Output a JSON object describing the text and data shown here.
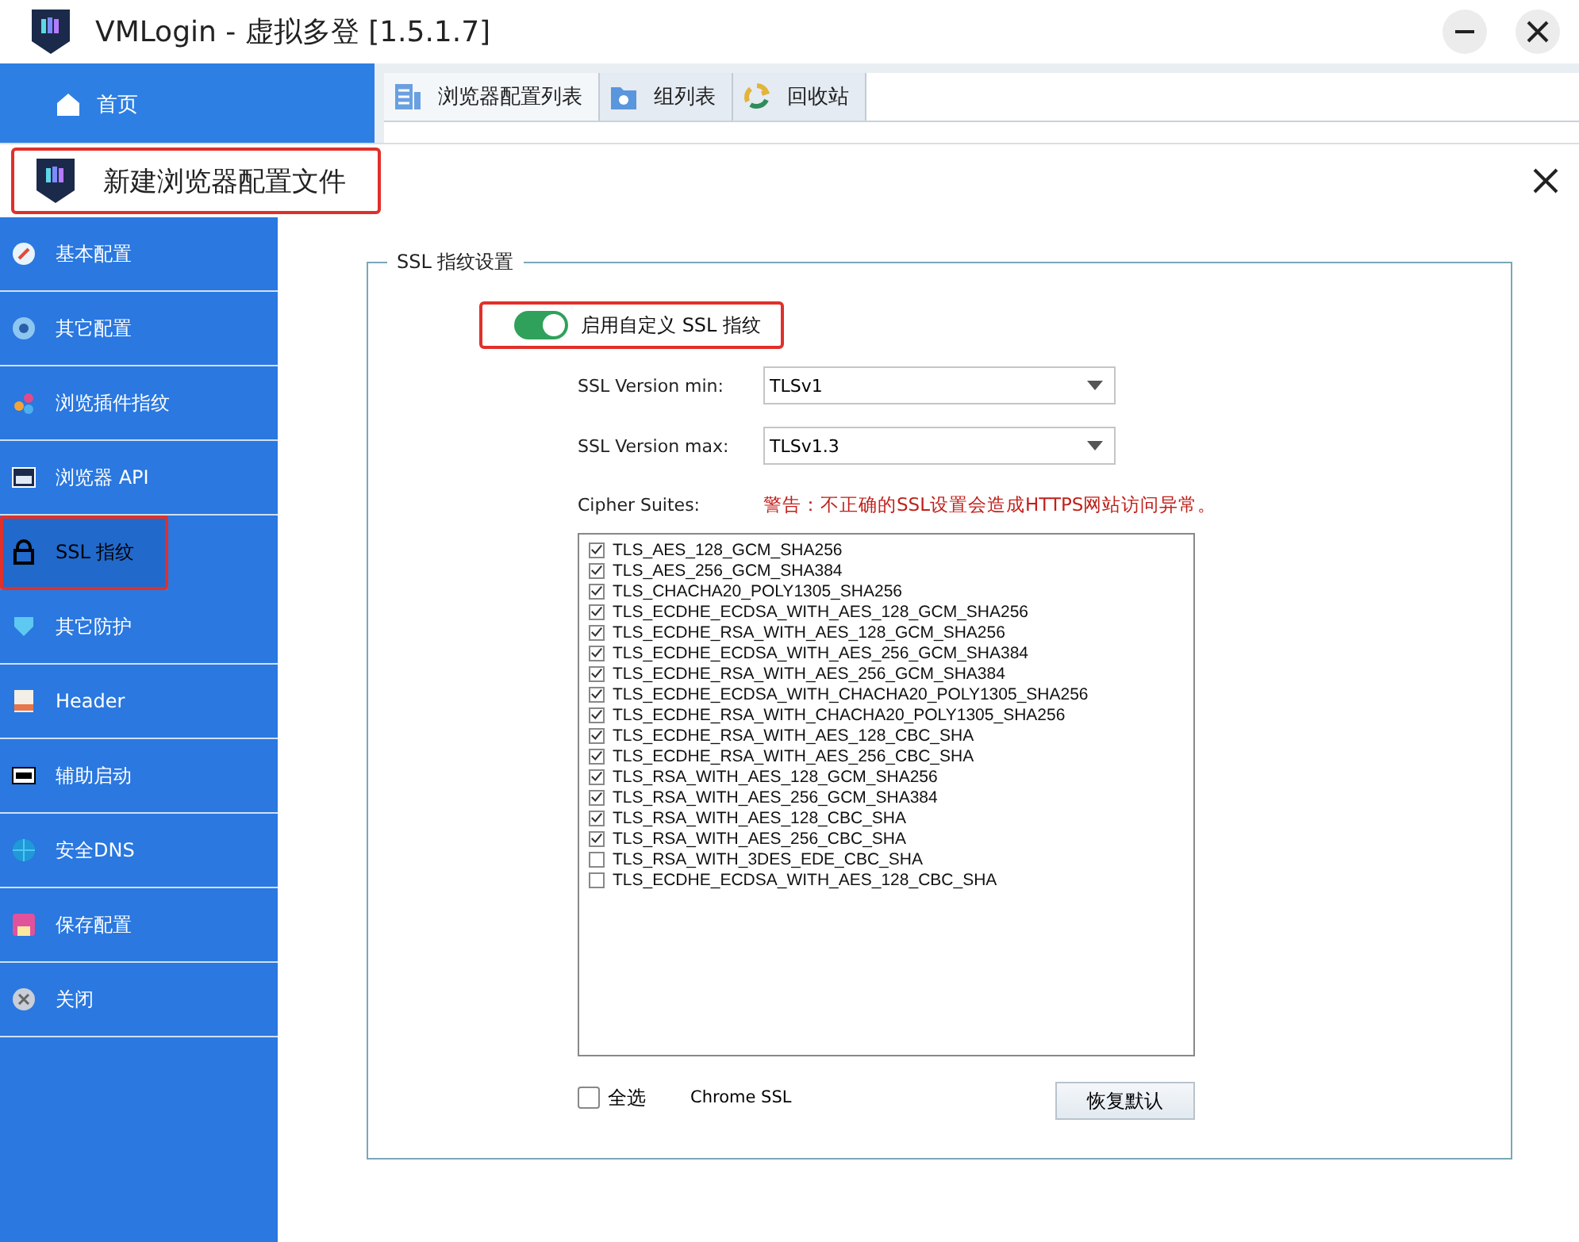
{
  "window": {
    "title": "VMLogin - 虚拟多登 [1.5.1.7]"
  },
  "main_nav": {
    "home": "首页"
  },
  "tabs": [
    {
      "label": "浏览器配置列表",
      "selected": true
    },
    {
      "label": "组列表",
      "selected": false
    },
    {
      "label": "回收站",
      "selected": false
    }
  ],
  "dialog": {
    "title": "新建浏览器配置文件",
    "highlighted": true
  },
  "sidebar": {
    "items": [
      {
        "label": "基本配置",
        "selected": false,
        "highlighted": false
      },
      {
        "label": "其它配置",
        "selected": false,
        "highlighted": false
      },
      {
        "label": "浏览插件指纹",
        "selected": false,
        "highlighted": false
      },
      {
        "label": "浏览器 API",
        "selected": false,
        "highlighted": false
      },
      {
        "label": "SSL 指纹",
        "selected": true,
        "highlighted": true
      },
      {
        "label": "其它防护",
        "selected": false,
        "highlighted": false
      },
      {
        "label": "Header",
        "selected": false,
        "highlighted": false
      },
      {
        "label": "辅助启动",
        "selected": false,
        "highlighted": false
      },
      {
        "label": "安全DNS",
        "selected": false,
        "highlighted": false
      },
      {
        "label": "保存配置",
        "selected": false,
        "highlighted": false
      },
      {
        "label": "关闭",
        "selected": false,
        "highlighted": false
      }
    ]
  },
  "ssl": {
    "group_title": "SSL 指纹设置",
    "toggle": {
      "label": "启用自定义 SSL 指纹",
      "on": true,
      "highlighted": true
    },
    "version_min": {
      "label": "SSL Version min:",
      "value": "TLSv1"
    },
    "version_max": {
      "label": "SSL Version max:",
      "value": "TLSv1.3"
    },
    "cipher_label": "Cipher Suites:",
    "warning": "警告：不正确的SSL设置会造成HTTPS网站访问异常。",
    "ciphers": [
      {
        "name": "TLS_AES_128_GCM_SHA256",
        "checked": true
      },
      {
        "name": "TLS_AES_256_GCM_SHA384",
        "checked": true
      },
      {
        "name": "TLS_CHACHA20_POLY1305_SHA256",
        "checked": true
      },
      {
        "name": "TLS_ECDHE_ECDSA_WITH_AES_128_GCM_SHA256",
        "checked": true
      },
      {
        "name": "TLS_ECDHE_RSA_WITH_AES_128_GCM_SHA256",
        "checked": true
      },
      {
        "name": "TLS_ECDHE_ECDSA_WITH_AES_256_GCM_SHA384",
        "checked": true
      },
      {
        "name": "TLS_ECDHE_RSA_WITH_AES_256_GCM_SHA384",
        "checked": true
      },
      {
        "name": "TLS_ECDHE_ECDSA_WITH_CHACHA20_POLY1305_SHA256",
        "checked": true
      },
      {
        "name": "TLS_ECDHE_RSA_WITH_CHACHA20_POLY1305_SHA256",
        "checked": true
      },
      {
        "name": "TLS_ECDHE_RSA_WITH_AES_128_CBC_SHA",
        "checked": true
      },
      {
        "name": "TLS_ECDHE_RSA_WITH_AES_256_CBC_SHA",
        "checked": true
      },
      {
        "name": "TLS_RSA_WITH_AES_128_GCM_SHA256",
        "checked": true
      },
      {
        "name": "TLS_RSA_WITH_AES_256_GCM_SHA384",
        "checked": true
      },
      {
        "name": "TLS_RSA_WITH_AES_128_CBC_SHA",
        "checked": true
      },
      {
        "name": "TLS_RSA_WITH_AES_256_CBC_SHA",
        "checked": true
      },
      {
        "name": "TLS_RSA_WITH_3DES_EDE_CBC_SHA",
        "checked": false
      },
      {
        "name": "TLS_ECDHE_ECDSA_WITH_AES_128_CBC_SHA",
        "checked": false
      }
    ],
    "select_all": {
      "label": "全选",
      "checked": false
    },
    "preset": "Chrome SSL",
    "reset_button": "恢复默认"
  }
}
